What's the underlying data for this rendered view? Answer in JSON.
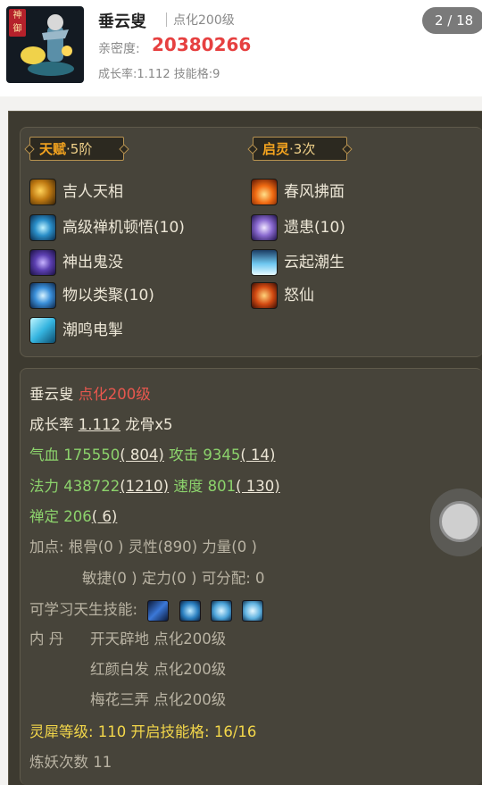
{
  "header": {
    "god_tag": "神御",
    "pet_name": "垂云叟",
    "pet_sub": "点化200级",
    "intimacy_label": "亲密度:",
    "intimacy_value": "20380266",
    "growth_line": "成长率:1.112  技能格:9",
    "page_indicator": "2 / 18"
  },
  "talent": {
    "title": "天赋",
    "suffix": "·5阶"
  },
  "awaken": {
    "title": "启灵",
    "suffix": "·3次"
  },
  "talent_skills": [
    {
      "name": "吉人天相",
      "icon": "golden-lion-icon"
    },
    {
      "name": "高级禅机顿悟(10)",
      "icon": "zen-rune-icon"
    },
    {
      "name": "神出鬼没",
      "icon": "stealth-rune-icon"
    },
    {
      "name": "物以类聚(10)",
      "icon": "blue-orb-icon"
    },
    {
      "name": "潮鸣电掣",
      "icon": "tide-icon"
    }
  ],
  "awaken_skills": [
    {
      "name": "春风拂面",
      "icon": "flame-icon"
    },
    {
      "name": "遗患(10)",
      "icon": "purple-cloud-icon"
    },
    {
      "name": "云起潮生",
      "icon": "wave-icon"
    },
    {
      "name": "怒仙",
      "icon": "fire-face-icon"
    }
  ],
  "details": {
    "name": "垂云叟",
    "name_level": "点化200级",
    "growth_label": "成长率",
    "growth_value": "1.112",
    "dragon_bone": "龙骨x5",
    "hp_label": "气血",
    "hp_value": "175550",
    "hp_bonus": "( 804)",
    "atk_label": "攻击",
    "atk_value": "9345",
    "atk_bonus": "( 14)",
    "mp_label": "法力",
    "mp_value": "438722",
    "mp_bonus": "(1210)",
    "spd_label": "速度",
    "spd_value": "801",
    "spd_bonus": "( 130)",
    "zen_label": "禅定",
    "zen_value": "206",
    "zen_bonus": "( 6)",
    "points_line1": "加点:  根骨(0 ) 灵性(890) 力量(0 )",
    "points_line2": "敏捷(0 ) 定力(0 ) 可分配: 0",
    "learnable_label": "可学习天生技能:",
    "neidan_label": "内    丹",
    "neidan": [
      "开天辟地 点化200级",
      "红颜白发 点化200级",
      "梅花三弄 点化200级"
    ],
    "rhino_line": "灵犀等级: 110 开启技能格: 16/16",
    "refine_line": "炼妖次数 11"
  },
  "colors": {
    "intimacy": "#e64040",
    "panel_bg": "#3d3a30",
    "green_stat": "#8cd36c",
    "red_level": "#e8574e",
    "yellow_line": "#f3d74a",
    "header_gold": "#f3a31f"
  }
}
